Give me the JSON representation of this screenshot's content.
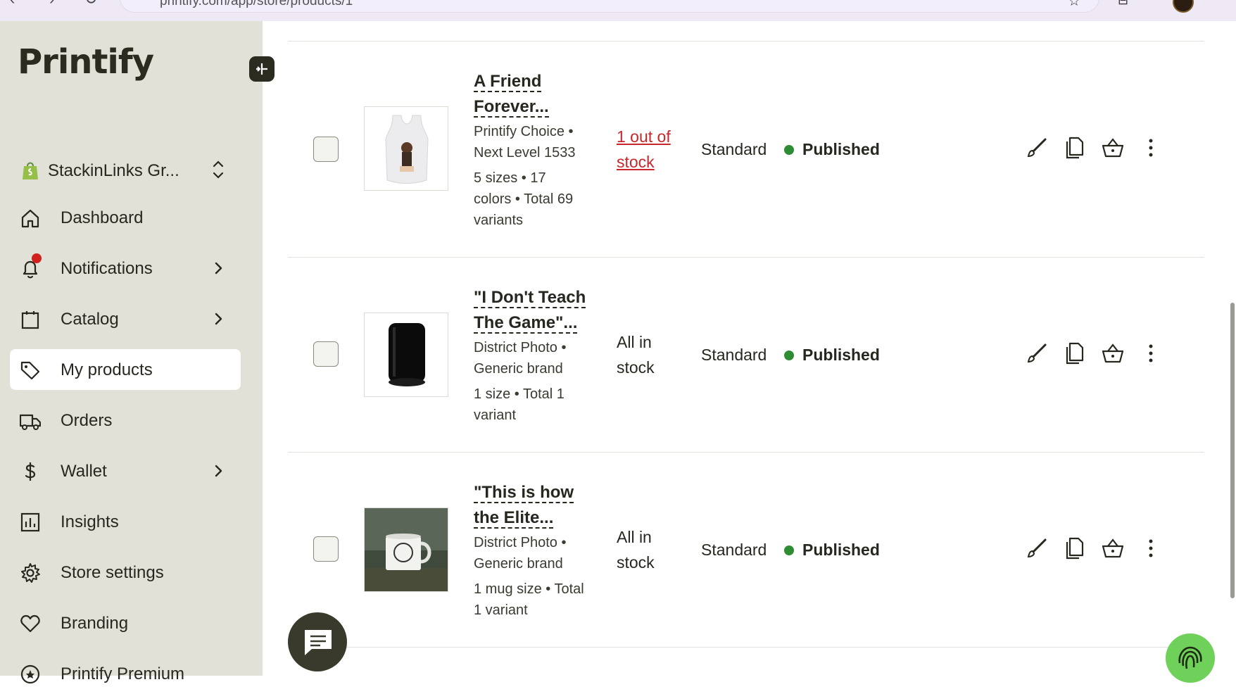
{
  "browser": {
    "url": "printify.com/app/store/products/1"
  },
  "sidebar": {
    "logo": "Printify",
    "store_name": "StackinLinks Gr...",
    "items": [
      {
        "label": "Dashboard",
        "icon": "home-icon"
      },
      {
        "label": "Notifications",
        "icon": "bell-icon",
        "badge": true
      },
      {
        "label": "Catalog",
        "icon": "clipboard-icon"
      },
      {
        "label": "My products",
        "icon": "tag-icon",
        "active": true
      },
      {
        "label": "Orders",
        "icon": "truck-icon"
      },
      {
        "label": "Wallet",
        "icon": "dollar-icon"
      },
      {
        "label": "Insights",
        "icon": "chart-icon"
      },
      {
        "label": "Store settings",
        "icon": "gear-icon"
      },
      {
        "label": "Branding",
        "icon": "heart-icon"
      },
      {
        "label": "Printify Premium",
        "icon": "premium-icon"
      }
    ]
  },
  "products": [
    {
      "title_line1": "A Friend",
      "title_line2": "Forever...",
      "provider_line1": "Printify Choice •",
      "provider_line2": "Next Level 1533",
      "variants_line1": "5 sizes • 17",
      "variants_line2": "colors • Total 69",
      "variants_line3": "variants",
      "stock_line1": "1 out of",
      "stock_line2": "stock",
      "tier": "Standard",
      "status": "Published"
    },
    {
      "title_line1": "\"I Don't Teach",
      "title_line2": "The Game\"...",
      "provider_line1": "District Photo •",
      "provider_line2": "Generic brand",
      "variants_line1": "1 size • Total 1",
      "variants_line2": "variant",
      "stock_line1": "All in",
      "stock_line2": "stock",
      "tier": "Standard",
      "status": "Published"
    },
    {
      "title_line1": "\"This is how",
      "title_line2": "the Elite...",
      "provider_line1": "District Photo •",
      "provider_line2": "Generic brand",
      "variants_line1": "1 mug size • Total",
      "variants_line2": "1 variant",
      "stock_line1": "All in",
      "stock_line2": "stock",
      "tier": "Standard",
      "status": "Published"
    }
  ],
  "colors": {
    "sidebar_bg": "#e1e1d7",
    "accent_dark": "#2b2b1f",
    "published_dot": "#2e8c33",
    "out_of_stock": "#c8262b",
    "notification_dot": "#d0211c"
  }
}
